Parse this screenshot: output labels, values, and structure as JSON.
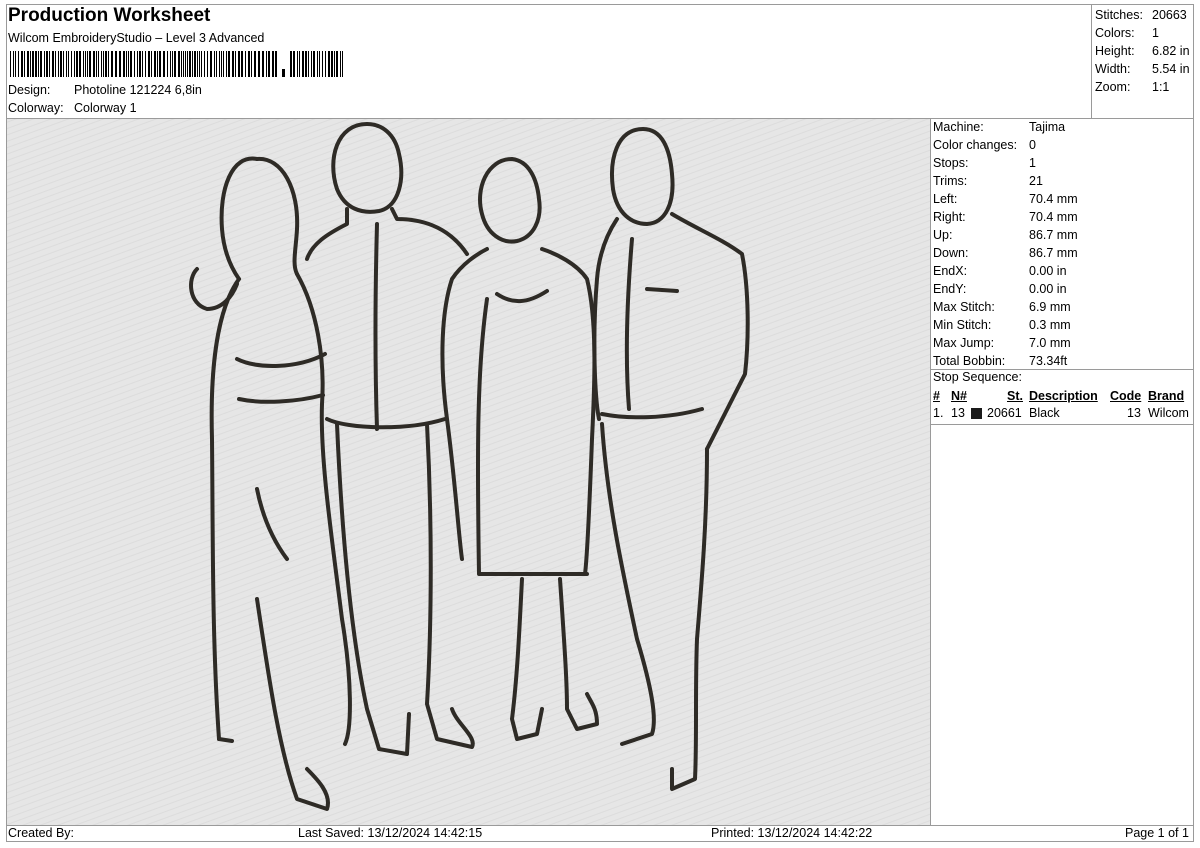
{
  "header": {
    "title": "Production Worksheet",
    "subtitle": "Wilcom EmbroideryStudio – Level 3 Advanced",
    "design_label": "Design:",
    "design_value": "Photoline 121224 6,8in",
    "colorway_label": "Colorway:",
    "colorway_value": "Colorway 1"
  },
  "summary": [
    {
      "label": "Stitches:",
      "value": "20663"
    },
    {
      "label": "Colors:",
      "value": "1"
    },
    {
      "label": "Height:",
      "value": "6.82 in"
    },
    {
      "label": "Width:",
      "value": "5.54 in"
    },
    {
      "label": "Zoom:",
      "value": "1:1"
    }
  ],
  "machine_stats": [
    {
      "label": "Machine:",
      "value": "Tajima"
    },
    {
      "label": "Color changes:",
      "value": "0"
    },
    {
      "label": "Stops:",
      "value": "1"
    },
    {
      "label": "Trims:",
      "value": "21"
    },
    {
      "label": "Left:",
      "value": "70.4 mm"
    },
    {
      "label": "Right:",
      "value": "70.4 mm"
    },
    {
      "label": "Up:",
      "value": "86.7 mm"
    },
    {
      "label": "Down:",
      "value": "86.7 mm"
    },
    {
      "label": "EndX:",
      "value": "0.00 in"
    },
    {
      "label": "EndY:",
      "value": "0.00 in"
    },
    {
      "label": "Max Stitch:",
      "value": "6.9 mm"
    },
    {
      "label": "Min Stitch:",
      "value": "0.3 mm"
    },
    {
      "label": "Max Jump:",
      "value": "7.0 mm"
    },
    {
      "label": "Total Bobbin:",
      "value": "73.34ft"
    }
  ],
  "stop_sequence": {
    "title": "Stop Sequence:",
    "columns": {
      "num": "#",
      "n": "N#",
      "st": "St.",
      "description": "Description",
      "code": "Code",
      "brand": "Brand"
    },
    "rows": [
      {
        "num": "1.",
        "n": "13",
        "st": "20661",
        "description": "Black",
        "code": "13",
        "brand": "Wilcom",
        "color": "#1a1a1a"
      }
    ]
  },
  "footer": {
    "created_by": "Created By:",
    "last_saved": "Last Saved: 13/12/2024 14:42:15",
    "printed": "Printed: 13/12/2024 14:42:22",
    "page": "Page 1 of 1"
  },
  "colors": {
    "thread": "#2e2b26",
    "canvas_bg": "#e6e6e6",
    "border": "#9a9a9a"
  }
}
